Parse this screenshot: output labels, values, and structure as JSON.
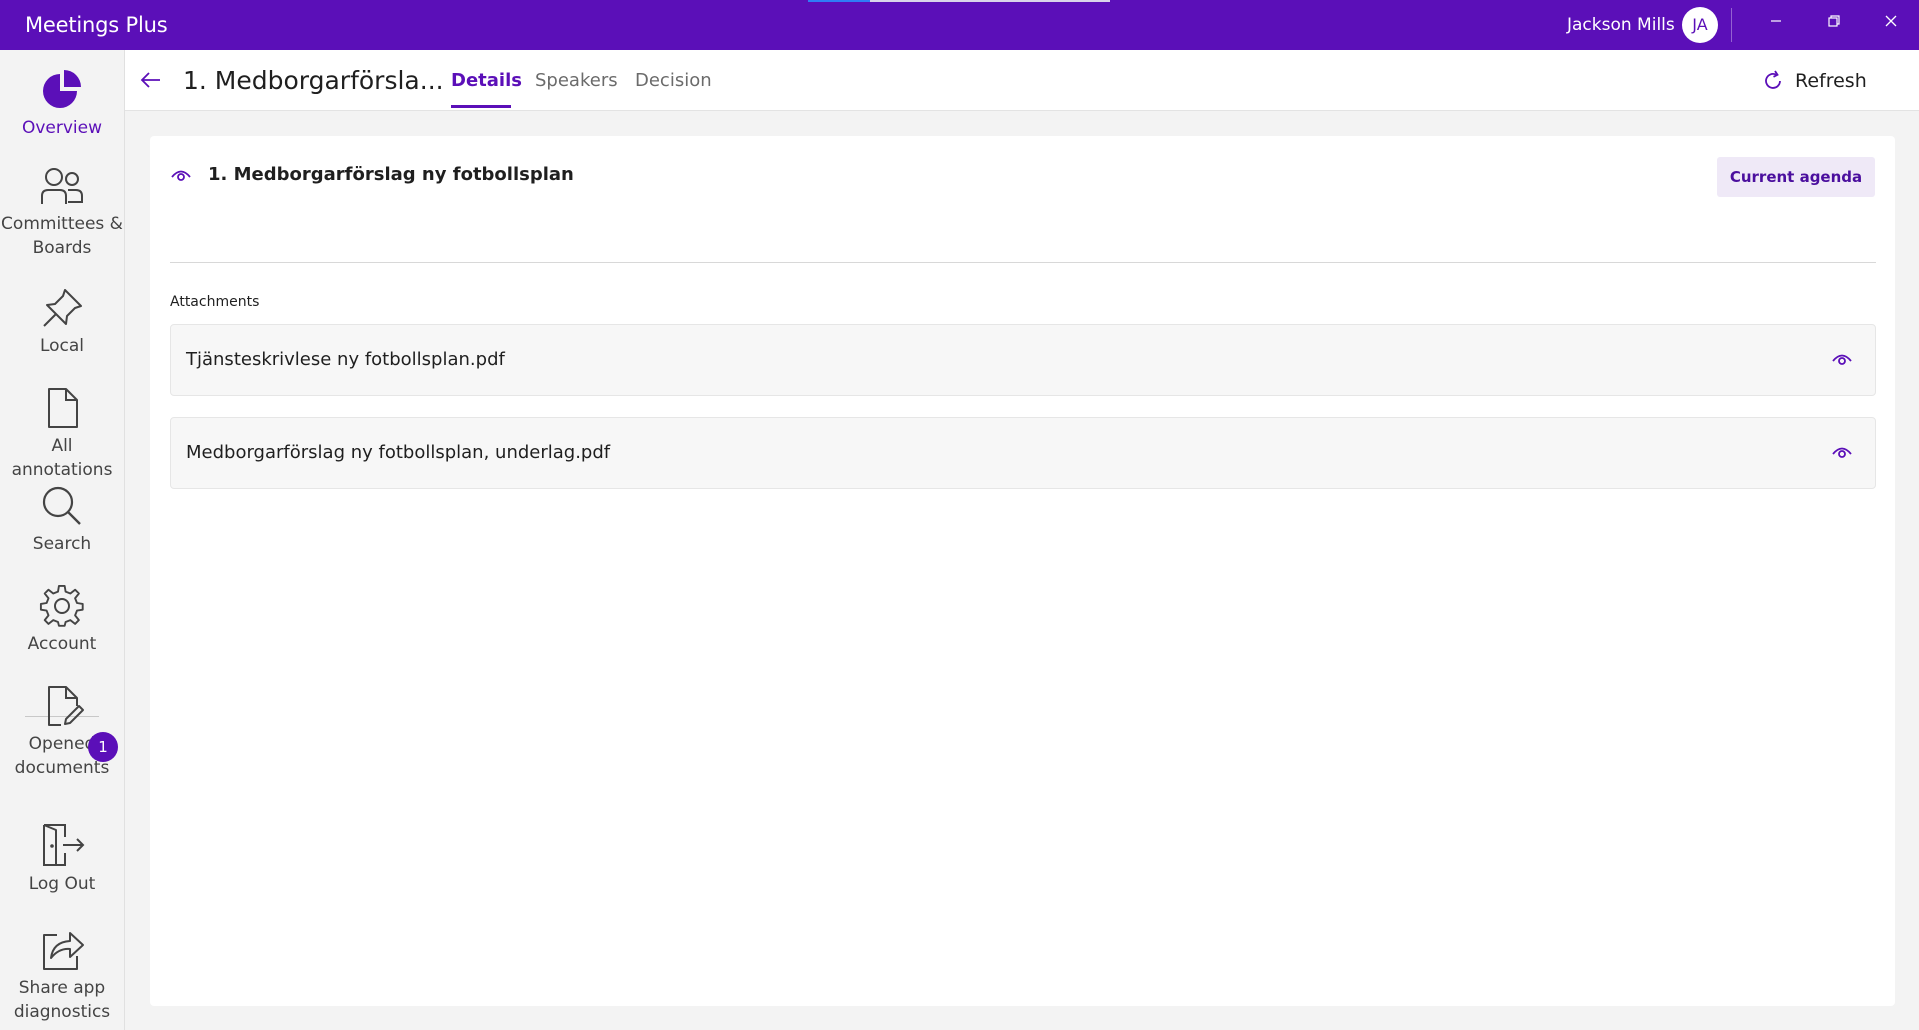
{
  "window": {
    "app_title": "Meetings Plus",
    "user_name": "Jackson Mills",
    "avatar_initials": "JA"
  },
  "sidebar": {
    "items": [
      {
        "label": "Overview",
        "icon": "pie-chart-icon"
      },
      {
        "label": "Committees & Boards",
        "icon": "people-icon"
      },
      {
        "label": "Local",
        "icon": "pin-icon"
      },
      {
        "label": "All annotations",
        "icon": "document-icon"
      },
      {
        "label": "Search",
        "icon": "search-icon"
      },
      {
        "label": "Account",
        "icon": "gear-icon"
      },
      {
        "label": "Opened documents",
        "icon": "document-edit-icon",
        "badge": "1"
      },
      {
        "label": "Log Out",
        "icon": "logout-icon"
      },
      {
        "label": "Share app diagnostics",
        "icon": "share-icon"
      }
    ]
  },
  "header": {
    "title": "1. Medborgarförsla...",
    "tabs": [
      {
        "label": "Details",
        "active": true
      },
      {
        "label": "Speakers",
        "active": false
      },
      {
        "label": "Decision",
        "active": false
      }
    ],
    "refresh_label": "Refresh"
  },
  "item": {
    "title": "1. Medborgarförslag ny fotbollsplan",
    "current_agenda_label": "Current agenda"
  },
  "attachments": {
    "label": "Attachments",
    "files": [
      {
        "name": "Tjänsteskrivlese ny fotbollsplan.pdf"
      },
      {
        "name": "Medborgarförslag ny fotbollsplan, underlag.pdf"
      }
    ]
  },
  "colors": {
    "accent": "#5b0fb8",
    "accent_light": "#efe9f7",
    "background": "#f3f3f3"
  }
}
